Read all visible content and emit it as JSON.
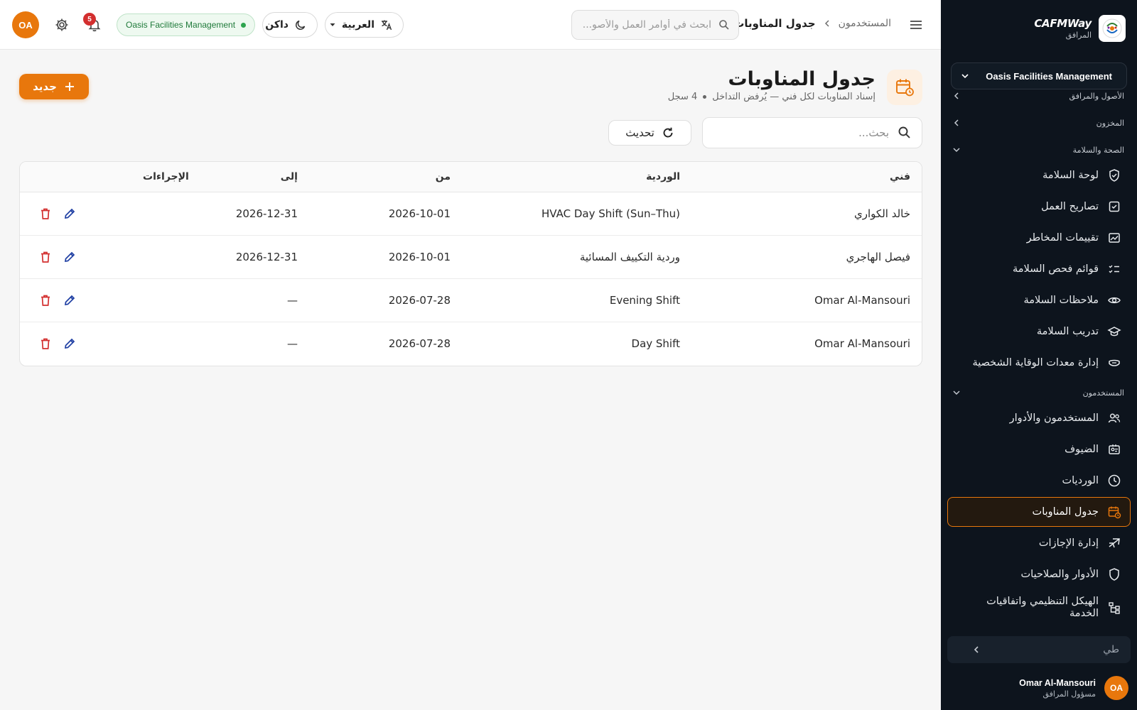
{
  "sidebar": {
    "brand_name": "CAFMWay",
    "brand_sub": "المرافق",
    "org_select": "Oasis Facilities Management",
    "sections": {
      "assets": "الأصول والمرافق",
      "inventory": "المخزون",
      "hse": "الصحة والسلامة",
      "users": "المستخدمون"
    },
    "items": [
      {
        "label": "لوحة السلامة",
        "icon": "shield-check-icon"
      },
      {
        "label": "تصاريح العمل",
        "icon": "clipboard-check-icon"
      },
      {
        "label": "تقييمات المخاطر",
        "icon": "chart-image-icon"
      },
      {
        "label": "قوائم فحص السلامة",
        "icon": "checklist-icon"
      },
      {
        "label": "ملاحظات السلامة",
        "icon": "eye-icon"
      },
      {
        "label": "تدريب السلامة",
        "icon": "graduation-cap-icon"
      },
      {
        "label": "إدارة معدات الوقاية الشخصية",
        "icon": "mask-icon"
      },
      {
        "label": "المستخدمون والأدوار",
        "icon": "users-icon"
      },
      {
        "label": "الضيوف",
        "icon": "visitor-badge-icon"
      },
      {
        "label": "الورديات",
        "icon": "clock-icon"
      },
      {
        "label": "جدول المناوبات",
        "icon": "calendar-clock-icon"
      },
      {
        "label": "إدارة الإجازات",
        "icon": "plane-icon"
      },
      {
        "label": "الأدوار والصلاحيات",
        "icon": "shield-icon"
      },
      {
        "label": "الهيكل التنظيمي واتفاقيات الخدمة",
        "icon": "org-chart-icon"
      }
    ],
    "collapse_label": "طي",
    "user": {
      "initials": "OA",
      "name": "Omar Al-Mansouri",
      "role": "مسؤول المرافق"
    }
  },
  "topbar": {
    "breadcrumb_parent": "المستخدمون",
    "breadcrumb_current": "جدول المناوبات",
    "search_placeholder": "ابحث في أوامر العمل والأصو...",
    "language": "العربية",
    "theme": "داكن",
    "org_badge": "Oasis Facilities Management",
    "notification_count": "5",
    "avatar_initials": "OA"
  },
  "page": {
    "title": "جدول المناوبات",
    "subtitle": "إسناد المناوبات لكل فني — يُرفض التداخل",
    "record_count": "4 سجل",
    "new_button": "جديد",
    "search_placeholder": "بحث...",
    "refresh_button": "تحديث"
  },
  "table": {
    "headers": {
      "technician": "فني",
      "shift": "الوردية",
      "from": "من",
      "to": "إلى",
      "actions": "الإجراءات"
    },
    "rows": [
      {
        "technician": "خالد الكواري",
        "shift": "HVAC Day Shift (Sun–Thu)",
        "from": "2026-10-01",
        "to": "2026-12-31"
      },
      {
        "technician": "فيصل الهاجري",
        "shift": "وردية التكييف المسائية",
        "from": "2026-10-01",
        "to": "2026-12-31"
      },
      {
        "technician": "Omar Al-Mansouri",
        "shift": "Evening Shift",
        "from": "2026-07-28",
        "to": "—"
      },
      {
        "technician": "Omar Al-Mansouri",
        "shift": "Day Shift",
        "from": "2026-07-28",
        "to": "—"
      }
    ]
  },
  "colors": {
    "accent": "#e8770c",
    "sidebar_bg": "#0d141d",
    "edit_icon": "#1f3fa3",
    "delete_icon": "#d32f2f",
    "status_green": "#2ea44f"
  }
}
